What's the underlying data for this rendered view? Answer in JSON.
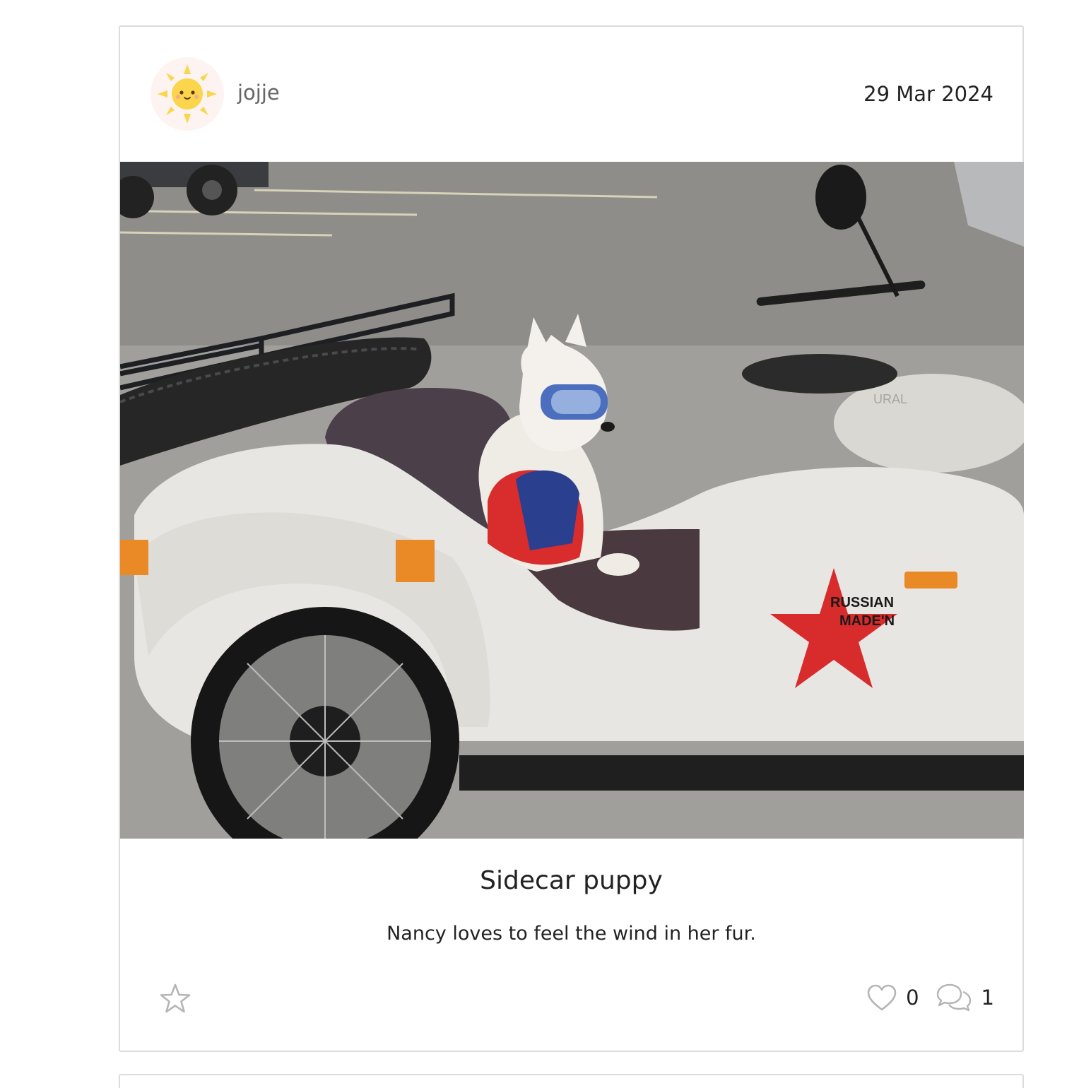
{
  "post": {
    "author": {
      "username": "jojje",
      "avatar_icon": "sun-icon"
    },
    "date": "29 Mar 2024",
    "image": {
      "subject": "white terrier dog wearing blue goggles and red vest sitting in white motorcycle sidecar",
      "decal_text_line1": "RUSSIAN",
      "decal_text_line2": "MADE'N",
      "tank_text": "URAL"
    },
    "title": "Sidecar puppy",
    "body": "Nancy loves to feel the wind in her fur.",
    "actions": {
      "favorite_icon": "star-outline-icon",
      "like_icon": "heart-outline-icon",
      "like_count": "0",
      "comment_icon": "comments-icon",
      "comment_count": "1"
    }
  },
  "colors": {
    "card_border": "#dcdcdc",
    "avatar_bg": "#fdf3f1",
    "sun": "#fbd54c",
    "icon_gray": "#bdbdbd",
    "text": "#222222",
    "username": "#666666"
  }
}
